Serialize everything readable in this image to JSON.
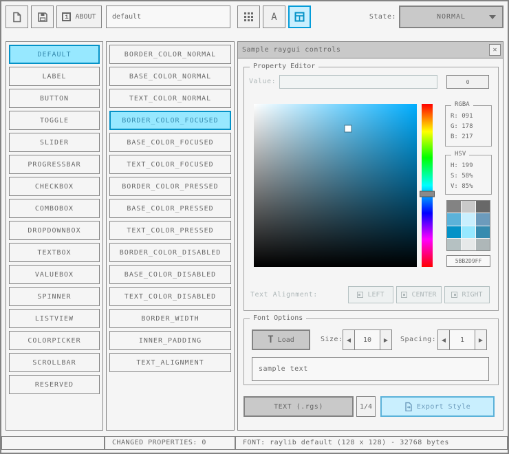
{
  "colors": {
    "selected_bg": "#97e8ff",
    "selected_border": "#0492c7",
    "selected_text": "#368baf",
    "focused_bg": "#c9effe",
    "focused_border": "#5bb2d9",
    "focused_text": "#6c9bbc",
    "picker_hue": "#00aeff"
  },
  "icons": {
    "info": "i",
    "font_a": "A",
    "close": "✕",
    "load_t": "T",
    "arrow_left": "◀",
    "arrow_right": "▶"
  },
  "toolbar": {
    "about_label": "ABOUT",
    "style_name": "default",
    "state_label": "State:",
    "state_value": "NORMAL"
  },
  "controls": {
    "selected": "DEFAULT",
    "items": [
      "DEFAULT",
      "LABEL",
      "BUTTON",
      "TOGGLE",
      "SLIDER",
      "PROGRESSBAR",
      "CHECKBOX",
      "COMBOBOX",
      "DROPDOWNBOX",
      "TEXTBOX",
      "VALUEBOX",
      "SPINNER",
      "LISTVIEW",
      "COLORPICKER",
      "SCROLLBAR",
      "RESERVED"
    ]
  },
  "properties": {
    "selected": "BORDER_COLOR_FOCUSED",
    "items": [
      "BORDER_COLOR_NORMAL",
      "BASE_COLOR_NORMAL",
      "TEXT_COLOR_NORMAL",
      "BORDER_COLOR_FOCUSED",
      "BASE_COLOR_FOCUSED",
      "TEXT_COLOR_FOCUSED",
      "BORDER_COLOR_PRESSED",
      "BASE_COLOR_PRESSED",
      "TEXT_COLOR_PRESSED",
      "BORDER_COLOR_DISABLED",
      "BASE_COLOR_DISABLED",
      "TEXT_COLOR_DISABLED",
      "BORDER_WIDTH",
      "INNER_PADDING",
      "TEXT_ALIGNMENT"
    ]
  },
  "sample_window": {
    "title": "Sample raygui controls",
    "property_editor": {
      "label": "Property Editor",
      "value_label": "Value:",
      "value_text": "",
      "value_button": "0",
      "picker": {
        "hue_deg": 199,
        "saturation_pct": 58,
        "value_pct": 85
      },
      "rgba": {
        "label": "RGBA",
        "r": "R: 091",
        "g": "G: 178",
        "b": "B: 217"
      },
      "hsv": {
        "label": "HSV",
        "h": "H: 199",
        "s": "S: 58%",
        "v": "V: 85%"
      },
      "palette": [
        "#838383",
        "#c9c9c9",
        "#686868",
        "#5bb2d9",
        "#c9effe",
        "#6c9bbc",
        "#0492c7",
        "#97e8ff",
        "#368baf",
        "#b5c1c2",
        "#e6e9e9",
        "#aeb7b8"
      ],
      "hex_value": "5BB2D9FF",
      "alignment_label": "Text Alignment:",
      "align_left": "LEFT",
      "align_center": "CENTER",
      "align_right": "RIGHT"
    },
    "font_options": {
      "label": "Font Options",
      "load_button": "Load",
      "size_label": "Size:",
      "size_value": "10",
      "spacing_label": "Spacing:",
      "spacing_value": "1",
      "sample_text": "sample text"
    },
    "footer": {
      "text_format_button": "TEXT (.rgs)",
      "page_indicator": "1/4",
      "export_button": "Export Style"
    }
  },
  "status_bar": {
    "left": "",
    "changed_properties": "CHANGED PROPERTIES: 0",
    "font_info": "FONT: raylib default (128 x 128) - 32768 bytes"
  }
}
